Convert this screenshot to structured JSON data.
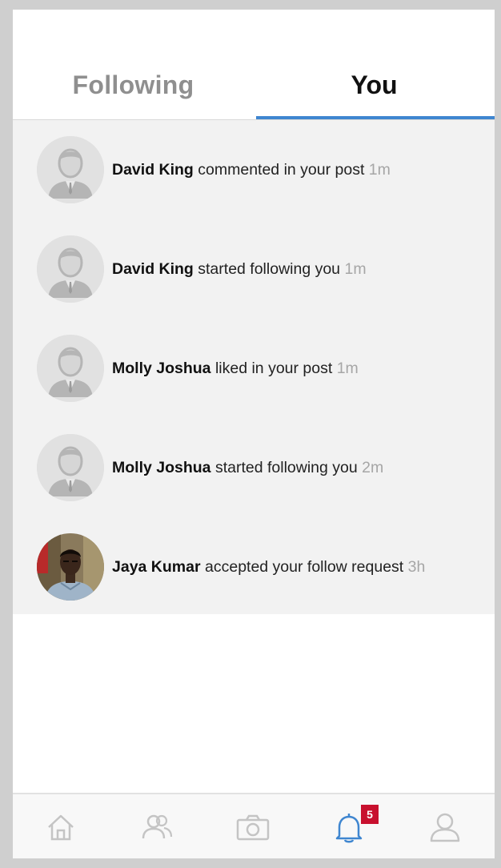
{
  "tabs": {
    "following_label": "Following",
    "you_label": "You",
    "active": "You"
  },
  "notifications": [
    {
      "name": "David King",
      "action": "commented in your post",
      "time": "1m",
      "avatar": "default-user-icon"
    },
    {
      "name": "David King",
      "action": "started following you",
      "time": "1m",
      "avatar": "default-user-icon"
    },
    {
      "name": "Molly Joshua",
      "action": "liked in your post",
      "time": "1m",
      "avatar": "default-user-icon"
    },
    {
      "name": "Molly Joshua",
      "action": "started following you",
      "time": "2m",
      "avatar": "default-user-icon"
    },
    {
      "name": "Jaya Kumar",
      "action": "accepted your follow request",
      "time": "3h",
      "avatar": "profile-photo"
    }
  ],
  "bottom_nav": {
    "items": [
      "home-icon",
      "friends-icon",
      "camera-icon",
      "bell-icon",
      "profile-icon"
    ],
    "active": "bell-icon",
    "notification_badge": "5"
  },
  "colors": {
    "accent": "#3f86d0",
    "badge": "#c8102e",
    "list_background": "#f2f2f2",
    "inactive_icon": "#c4c4c4"
  }
}
